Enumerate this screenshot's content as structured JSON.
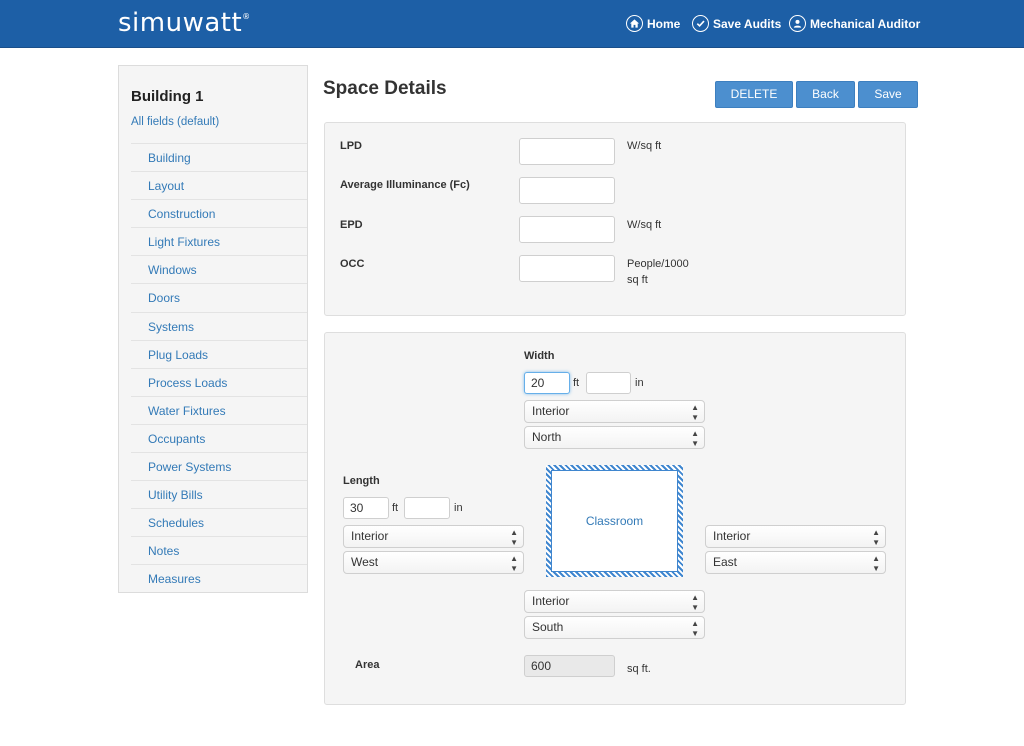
{
  "app": {
    "brand": "simuwatt",
    "brand_mark": "®"
  },
  "nav": {
    "home": "Home",
    "save_audits": "Save Audits",
    "user": "Mechanical Auditor"
  },
  "sidebar": {
    "title": "Building 1",
    "subtitle": "All fields (default)",
    "items": [
      "Building",
      "Layout",
      "Construction",
      "Light Fixtures",
      "Windows",
      "Doors",
      "Systems",
      "Plug Loads",
      "Process Loads",
      "Water Fixtures",
      "Occupants",
      "Power Systems",
      "Utility Bills",
      "Schedules",
      "Notes",
      "Measures"
    ]
  },
  "page": {
    "title": "Space Details"
  },
  "actions": {
    "delete": "DELETE",
    "back": "Back",
    "save": "Save"
  },
  "fields": {
    "lpd": {
      "label": "LPD",
      "value": "",
      "unit": "W/sq ft"
    },
    "illuminance": {
      "label": "Average Illuminance (Fc)",
      "value": ""
    },
    "epd": {
      "label": "EPD",
      "value": "",
      "unit": "W/sq ft"
    },
    "occ": {
      "label": "OCC",
      "value": "",
      "unit_line1": "People/1000",
      "unit_line2": "sq ft"
    }
  },
  "dimensions": {
    "width_label": "Width",
    "width_ft": "20",
    "width_in": "",
    "length_label": "Length",
    "length_ft": "30",
    "length_in": "",
    "ft": "ft",
    "in": "in",
    "north": {
      "type": "Interior",
      "direction": "North"
    },
    "west": {
      "type": "Interior",
      "direction": "West"
    },
    "east": {
      "type": "Interior",
      "direction": "East"
    },
    "south": {
      "type": "Interior",
      "direction": "South"
    },
    "room_name": "Classroom",
    "area_label": "Area",
    "area_value": "600",
    "area_unit": "sq ft."
  },
  "colors": {
    "navbar": "#1d5fa6",
    "button": "#4c8fcf",
    "link": "#337ab7"
  }
}
